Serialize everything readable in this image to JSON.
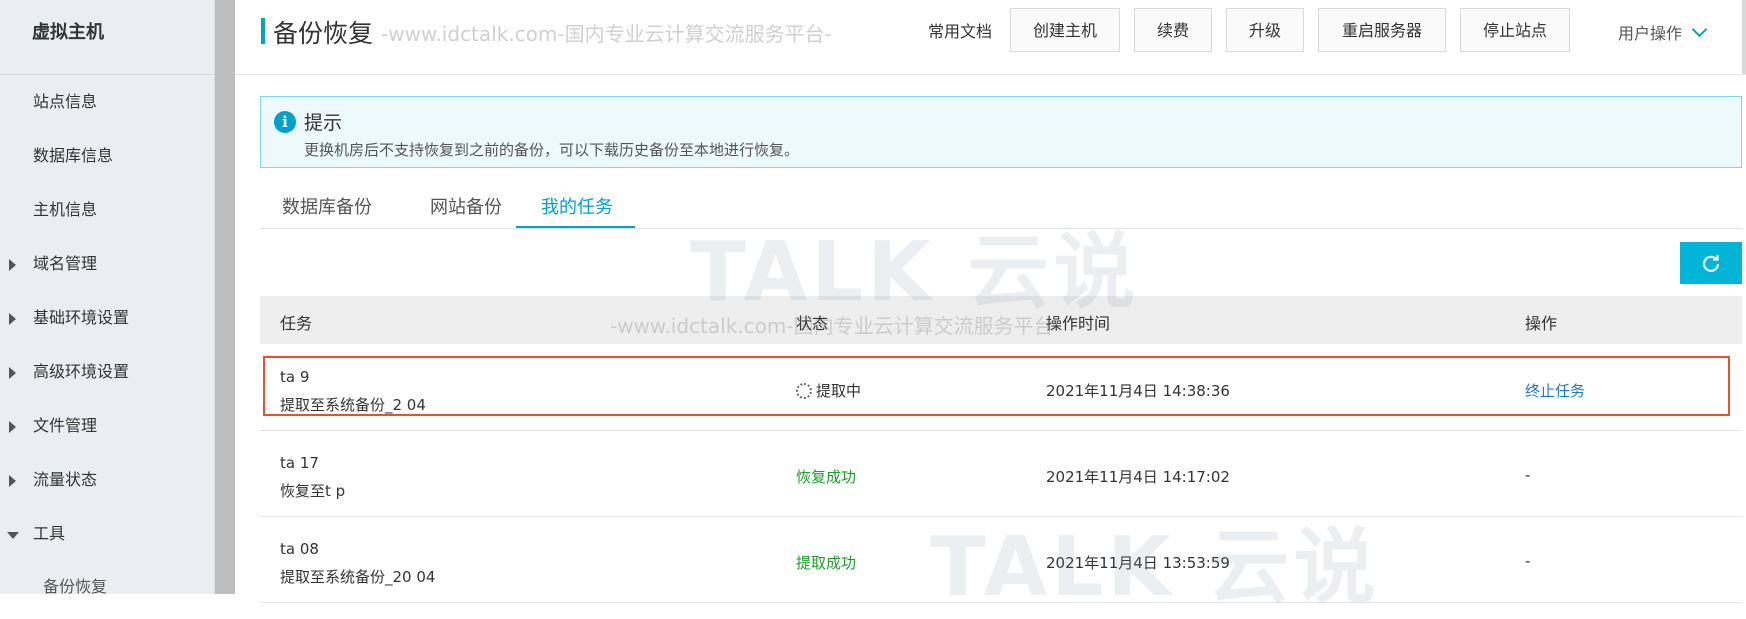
{
  "sidebar": {
    "title": "虚拟主机",
    "items": [
      {
        "label": "站点信息"
      },
      {
        "label": "数据库信息"
      },
      {
        "label": "主机信息"
      },
      {
        "label": "域名管理"
      },
      {
        "label": "基础环境设置"
      },
      {
        "label": "高级环境设置"
      },
      {
        "label": "文件管理"
      },
      {
        "label": "流量状态"
      },
      {
        "label": "工具"
      },
      {
        "label": "备份恢复"
      }
    ]
  },
  "header": {
    "title": "备份恢复",
    "watermark": "-www.idctalk.com-国内专业云计算交流服务平台-",
    "doc_link": "常用文档",
    "buttons": [
      "创建主机",
      "续费",
      "升级",
      "重启服务器",
      "停止站点"
    ],
    "user_menu": "用户操作"
  },
  "notice": {
    "title": "提示",
    "body": "更换机房后不支持恢复到之前的备份，可以下载历史备份至本地进行恢复。"
  },
  "tabs": [
    "数据库备份",
    "网站备份",
    "我的任务"
  ],
  "active_tab": "我的任务",
  "table": {
    "headers": [
      "任务",
      "状态",
      "操作时间",
      "操作"
    ],
    "rows": [
      {
        "task_id": "ta  9",
        "task_desc": "提取至系统备份_2  04",
        "status": "提取中",
        "time": "2021年11月4日 14:38:36",
        "op": "终止任务"
      },
      {
        "task_id": "ta  17",
        "task_desc": "恢复至t  p",
        "status": "恢复成功",
        "time": "2021年11月4日 14:17:02",
        "op": "-"
      },
      {
        "task_id": "ta  08",
        "task_desc": "提取至系统备份_20  04",
        "status": "提取成功",
        "time": "2021年11月4日 13:53:59",
        "op": "-"
      }
    ]
  },
  "watermarks": {
    "brand": "TALK 云说",
    "line": "-www.idctalk.com-国内专业云计算交流服务平台-"
  },
  "colors": {
    "accent": "#00a2ca",
    "success": "#1e9e2a",
    "link": "#1f7ac9",
    "highlight": "#e8502e"
  }
}
